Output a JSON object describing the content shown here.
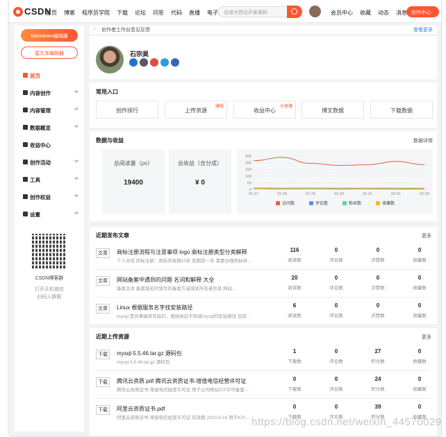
{
  "topbar": {
    "logo_text": "CSDN",
    "nav": [
      "首页",
      "博客",
      "程序员学院",
      "下载",
      "论坛",
      "问答",
      "代码",
      "直播",
      "电子书"
    ],
    "search_placeholder": "合成大西瓜开发源码",
    "right_nav": [
      "会员中心",
      "收藏",
      "动态",
      "消息"
    ],
    "create_label": "创作中心"
  },
  "sidebar": {
    "markdown_button": "Markdown编辑器",
    "richtext_button": "富文本编辑器",
    "items": [
      {
        "label": "首页",
        "icon": "home-icon",
        "active": true
      },
      {
        "label": "内容创作",
        "icon": "edit-icon"
      },
      {
        "label": "内容管理",
        "icon": "folder-icon"
      },
      {
        "label": "数据概览",
        "icon": "chart-icon"
      },
      {
        "label": "收益中心",
        "icon": "coin-icon"
      },
      {
        "label": "创作活动",
        "icon": "activity-icon"
      },
      {
        "label": "工具",
        "icon": "tool-icon"
      },
      {
        "label": "创作权益",
        "icon": "gift-icon"
      },
      {
        "label": "设置",
        "icon": "settings-icon"
      }
    ],
    "qr_title": "CSDN博客群",
    "qr_sub1": "打开手机微信",
    "qr_sub2": "扫码入群聊"
  },
  "feedback": {
    "text": "创作者工作台意见反馈",
    "more": "查看更多"
  },
  "profile": {
    "name": "石宗昊"
  },
  "common": {
    "title": "常用入口",
    "items": [
      {
        "label": "创作排行",
        "tag": ""
      },
      {
        "label": "上传资源",
        "tag": "赚钱"
      },
      {
        "label": "收益中心",
        "tag": "分享赚"
      },
      {
        "label": "博文数据",
        "tag": ""
      },
      {
        "label": "下载数据",
        "tag": ""
      }
    ]
  },
  "stats": {
    "title": "数据与收益",
    "more": "数据详情",
    "reads_label": "总阅读量（pv）",
    "reads_value": "19400",
    "income_label": "总收益（含分成）",
    "income_value": "¥ 0"
  },
  "chart_data": {
    "type": "line",
    "x": [
      "01-27",
      "01-28",
      "01-29",
      "01-30",
      "01-31",
      "02-01",
      "02-02"
    ],
    "yticks": [
      0,
      50,
      100,
      150,
      200,
      250
    ],
    "ylim": [
      0,
      250
    ],
    "legend_position": "bottom",
    "series": [
      {
        "name": "访问数",
        "color": "#e3623e",
        "values": [
          215,
          240,
          195,
          180,
          185,
          210,
          185
        ]
      },
      {
        "name": "评论数",
        "color": "#5b8ff9",
        "values": [
          5,
          3,
          4,
          2,
          3,
          2,
          3
        ]
      },
      {
        "name": "粉丝数",
        "color": "#5ad8a6",
        "values": [
          12,
          10,
          11,
          10,
          9,
          10,
          9
        ]
      },
      {
        "name": "收藏数",
        "color": "#f6bd16",
        "values": [
          8,
          7,
          6,
          7,
          6,
          7,
          8
        ]
      }
    ]
  },
  "articles": {
    "title": "近期发布文章",
    "more": "更多",
    "stat_labels": [
      "阅读数",
      "评论数",
      "点赞数",
      "收藏数"
    ],
    "rows": [
      {
        "type": "文章",
        "title": "商标注册流程与注意事项 logo 商标注册类型分类解释",
        "desc": "个人总结 商标注册：商标有效期10年 到期前一年 需要办理商标续…",
        "values": [
          "116",
          "0",
          "0",
          "0"
        ]
      },
      {
        "type": "文章",
        "title": "网站备案中遇到的问题 名词和解释 大全",
        "desc": "备案主体 备案域名时填写的备案方或域名所有者信息 网站…",
        "values": [
          "20",
          "0",
          "0",
          "0"
        ]
      },
      {
        "type": "文章",
        "title": "Linux 根据服务名字找安装路径",
        "desc": "mysql 是同事编译安装的，我接收后不知道mysql的安装路径 目前…",
        "values": [
          "6",
          "0",
          "0",
          "0"
        ]
      }
    ]
  },
  "resources": {
    "title": "近期上传资源",
    "more": "更多",
    "stat_labels": [
      "下载数",
      "评论数",
      "积分数",
      "收藏数"
    ],
    "rows": [
      {
        "type": "下载",
        "title": "mysql-5.5.46.tar.gz 源码包",
        "desc": "mysql-5.5.46.tar.gz 源码包",
        "values": [
          "1",
          "0",
          "27",
          "0"
        ]
      },
      {
        "type": "下载",
        "title": "腾讯云资质.pdf 腾讯云资质证书-增值电信经营许可证",
        "desc": "腾讯云资质证书-增值电信经营许可证 用于公司网站ICP许可备案…",
        "values": [
          "0",
          "0",
          "24",
          "0"
        ]
      },
      {
        "type": "下载",
        "title": "阿里云资质证书.pdf",
        "desc": "阿里云资质证书-增值电信经营许可证 有效期-2023-5-18 用于ICP…",
        "values": [
          "0",
          "0",
          "39",
          "0"
        ]
      }
    ]
  },
  "watermark": "https://blog.csdn.net/weixin_44570029"
}
